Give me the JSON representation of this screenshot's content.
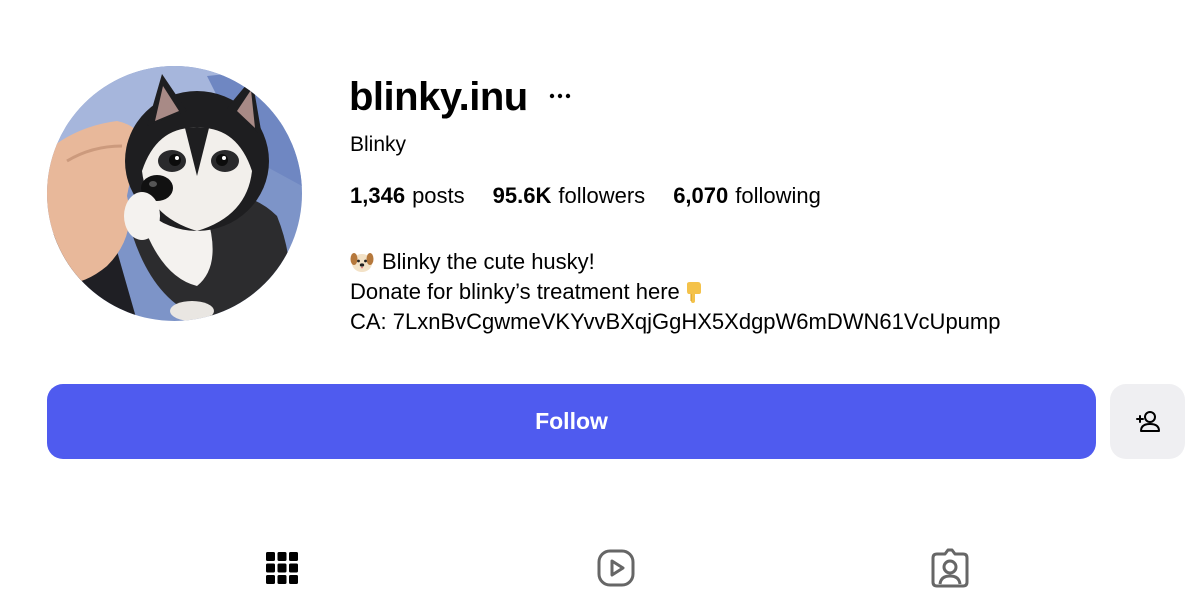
{
  "profile": {
    "username": "blinky.inu",
    "display_name": "Blinky",
    "more_icon": "more-horizontal-icon"
  },
  "stats": {
    "posts_count": "1,346",
    "posts_label": "posts",
    "followers_count": "95.6K",
    "followers_label": "followers",
    "following_count": "6,070",
    "following_label": "following"
  },
  "bio": {
    "line1_emoji": "dog-face-emoji",
    "line1_text": "Blinky the cute husky!",
    "line2_text": "Donate for blinky’s treatment here",
    "line2_emoji": "pointing-down-emoji",
    "line3_text": "CA: 7LxnBvCgwmeVKYvvBXqjGgHX5XdgpW6mDWN61VcUpump"
  },
  "actions": {
    "follow_label": "Follow",
    "follow_color": "#4f5bef",
    "suggest_icon": "add-person-icon"
  },
  "tabs": [
    {
      "name": "posts",
      "icon": "grid-icon"
    },
    {
      "name": "reels",
      "icon": "reels-play-icon"
    },
    {
      "name": "tagged",
      "icon": "tagged-person-icon"
    }
  ]
}
